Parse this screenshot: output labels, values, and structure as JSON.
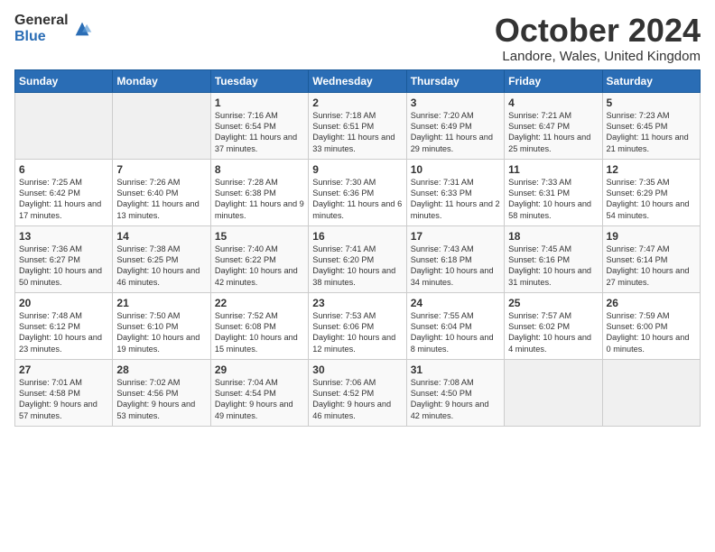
{
  "logo": {
    "general": "General",
    "blue": "Blue"
  },
  "title": "October 2024",
  "subtitle": "Landore, Wales, United Kingdom",
  "days_header": [
    "Sunday",
    "Monday",
    "Tuesday",
    "Wednesday",
    "Thursday",
    "Friday",
    "Saturday"
  ],
  "weeks": [
    [
      {
        "num": "",
        "info": ""
      },
      {
        "num": "",
        "info": ""
      },
      {
        "num": "1",
        "info": "Sunrise: 7:16 AM\nSunset: 6:54 PM\nDaylight: 11 hours and 37 minutes."
      },
      {
        "num": "2",
        "info": "Sunrise: 7:18 AM\nSunset: 6:51 PM\nDaylight: 11 hours and 33 minutes."
      },
      {
        "num": "3",
        "info": "Sunrise: 7:20 AM\nSunset: 6:49 PM\nDaylight: 11 hours and 29 minutes."
      },
      {
        "num": "4",
        "info": "Sunrise: 7:21 AM\nSunset: 6:47 PM\nDaylight: 11 hours and 25 minutes."
      },
      {
        "num": "5",
        "info": "Sunrise: 7:23 AM\nSunset: 6:45 PM\nDaylight: 11 hours and 21 minutes."
      }
    ],
    [
      {
        "num": "6",
        "info": "Sunrise: 7:25 AM\nSunset: 6:42 PM\nDaylight: 11 hours and 17 minutes."
      },
      {
        "num": "7",
        "info": "Sunrise: 7:26 AM\nSunset: 6:40 PM\nDaylight: 11 hours and 13 minutes."
      },
      {
        "num": "8",
        "info": "Sunrise: 7:28 AM\nSunset: 6:38 PM\nDaylight: 11 hours and 9 minutes."
      },
      {
        "num": "9",
        "info": "Sunrise: 7:30 AM\nSunset: 6:36 PM\nDaylight: 11 hours and 6 minutes."
      },
      {
        "num": "10",
        "info": "Sunrise: 7:31 AM\nSunset: 6:33 PM\nDaylight: 11 hours and 2 minutes."
      },
      {
        "num": "11",
        "info": "Sunrise: 7:33 AM\nSunset: 6:31 PM\nDaylight: 10 hours and 58 minutes."
      },
      {
        "num": "12",
        "info": "Sunrise: 7:35 AM\nSunset: 6:29 PM\nDaylight: 10 hours and 54 minutes."
      }
    ],
    [
      {
        "num": "13",
        "info": "Sunrise: 7:36 AM\nSunset: 6:27 PM\nDaylight: 10 hours and 50 minutes."
      },
      {
        "num": "14",
        "info": "Sunrise: 7:38 AM\nSunset: 6:25 PM\nDaylight: 10 hours and 46 minutes."
      },
      {
        "num": "15",
        "info": "Sunrise: 7:40 AM\nSunset: 6:22 PM\nDaylight: 10 hours and 42 minutes."
      },
      {
        "num": "16",
        "info": "Sunrise: 7:41 AM\nSunset: 6:20 PM\nDaylight: 10 hours and 38 minutes."
      },
      {
        "num": "17",
        "info": "Sunrise: 7:43 AM\nSunset: 6:18 PM\nDaylight: 10 hours and 34 minutes."
      },
      {
        "num": "18",
        "info": "Sunrise: 7:45 AM\nSunset: 6:16 PM\nDaylight: 10 hours and 31 minutes."
      },
      {
        "num": "19",
        "info": "Sunrise: 7:47 AM\nSunset: 6:14 PM\nDaylight: 10 hours and 27 minutes."
      }
    ],
    [
      {
        "num": "20",
        "info": "Sunrise: 7:48 AM\nSunset: 6:12 PM\nDaylight: 10 hours and 23 minutes."
      },
      {
        "num": "21",
        "info": "Sunrise: 7:50 AM\nSunset: 6:10 PM\nDaylight: 10 hours and 19 minutes."
      },
      {
        "num": "22",
        "info": "Sunrise: 7:52 AM\nSunset: 6:08 PM\nDaylight: 10 hours and 15 minutes."
      },
      {
        "num": "23",
        "info": "Sunrise: 7:53 AM\nSunset: 6:06 PM\nDaylight: 10 hours and 12 minutes."
      },
      {
        "num": "24",
        "info": "Sunrise: 7:55 AM\nSunset: 6:04 PM\nDaylight: 10 hours and 8 minutes."
      },
      {
        "num": "25",
        "info": "Sunrise: 7:57 AM\nSunset: 6:02 PM\nDaylight: 10 hours and 4 minutes."
      },
      {
        "num": "26",
        "info": "Sunrise: 7:59 AM\nSunset: 6:00 PM\nDaylight: 10 hours and 0 minutes."
      }
    ],
    [
      {
        "num": "27",
        "info": "Sunrise: 7:01 AM\nSunset: 4:58 PM\nDaylight: 9 hours and 57 minutes."
      },
      {
        "num": "28",
        "info": "Sunrise: 7:02 AM\nSunset: 4:56 PM\nDaylight: 9 hours and 53 minutes."
      },
      {
        "num": "29",
        "info": "Sunrise: 7:04 AM\nSunset: 4:54 PM\nDaylight: 9 hours and 49 minutes."
      },
      {
        "num": "30",
        "info": "Sunrise: 7:06 AM\nSunset: 4:52 PM\nDaylight: 9 hours and 46 minutes."
      },
      {
        "num": "31",
        "info": "Sunrise: 7:08 AM\nSunset: 4:50 PM\nDaylight: 9 hours and 42 minutes."
      },
      {
        "num": "",
        "info": ""
      },
      {
        "num": "",
        "info": ""
      }
    ]
  ]
}
